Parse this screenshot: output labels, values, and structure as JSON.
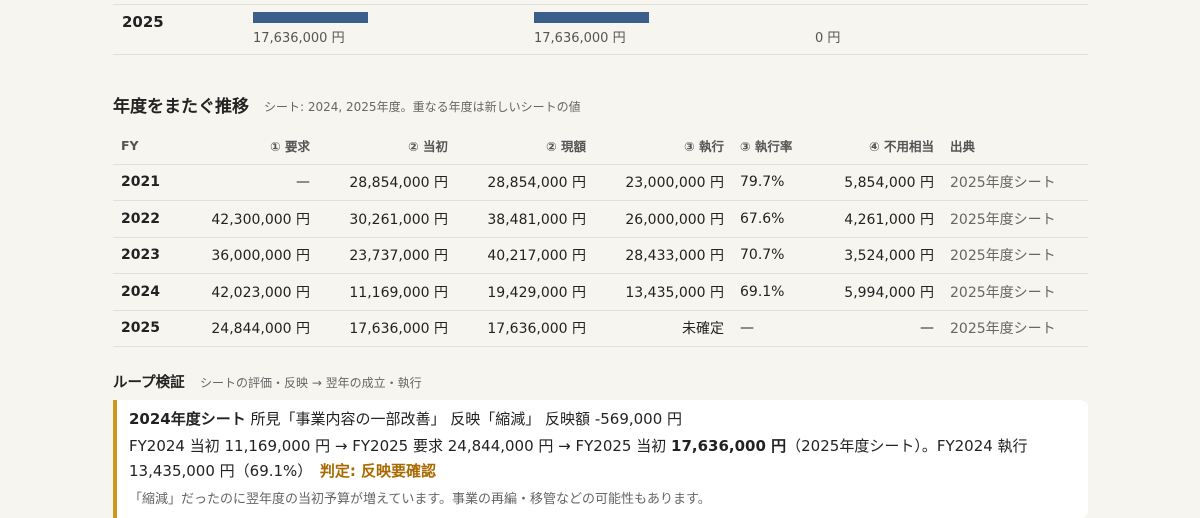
{
  "top_row": {
    "fy": "2025",
    "bar1_label": "17,636,000 円",
    "bar2_label": "17,636,000 円",
    "bar3_label": "0 円",
    "bar_color": "#3b5f8a"
  },
  "trend": {
    "title": "年度をまたぐ推移",
    "subtitle": "シート: 2024, 2025年度。重なる年度は新しいシートの値",
    "headers": [
      "FY",
      "① 要求",
      "② 当初",
      "② 現額",
      "③ 執行",
      "③ 執行率",
      "④ 不用相当",
      "出典"
    ],
    "rows": [
      [
        "2021",
        "—",
        "28,854,000 円",
        "28,854,000 円",
        "23,000,000 円",
        "79.7%",
        "5,854,000 円",
        "2025年度シート"
      ],
      [
        "2022",
        "42,300,000 円",
        "30,261,000 円",
        "38,481,000 円",
        "26,000,000 円",
        "67.6%",
        "4,261,000 円",
        "2025年度シート"
      ],
      [
        "2023",
        "36,000,000 円",
        "23,737,000 円",
        "40,217,000 円",
        "28,433,000 円",
        "70.7%",
        "3,524,000 円",
        "2025年度シート"
      ],
      [
        "2024",
        "42,023,000 円",
        "11,169,000 円",
        "19,429,000 円",
        "13,435,000 円",
        "69.1%",
        "5,994,000 円",
        "2025年度シート"
      ],
      [
        "2025",
        "24,844,000 円",
        "17,636,000 円",
        "17,636,000 円",
        "未確定",
        "—",
        "—",
        "2025年度シート"
      ]
    ]
  },
  "loop": {
    "title": "ループ検証",
    "subtitle": "シートの評価・反映 → 翌年の成立・執行",
    "card": {
      "sheet": "2024年度シート",
      "finding": " 所見「事業内容の一部改善」 反映「縮減」 反映額 -569,000 円",
      "line2_pre": "FY2024 当初 11,169,000 円 → FY2025 要求 24,844,000 円 → FY2025 当初 ",
      "line2_bold": "17,636,000 円",
      "line2_post": "（2025年度シート）。FY2024 執行 13,435,000 円（69.1%）　",
      "verdict": "判定: 反映要確認",
      "note": "「縮減」だったのに翌年度の当初予算が増えています。事業の再編・移管などの可能性もあります。",
      "accent_color": "#c99a1e"
    }
  }
}
